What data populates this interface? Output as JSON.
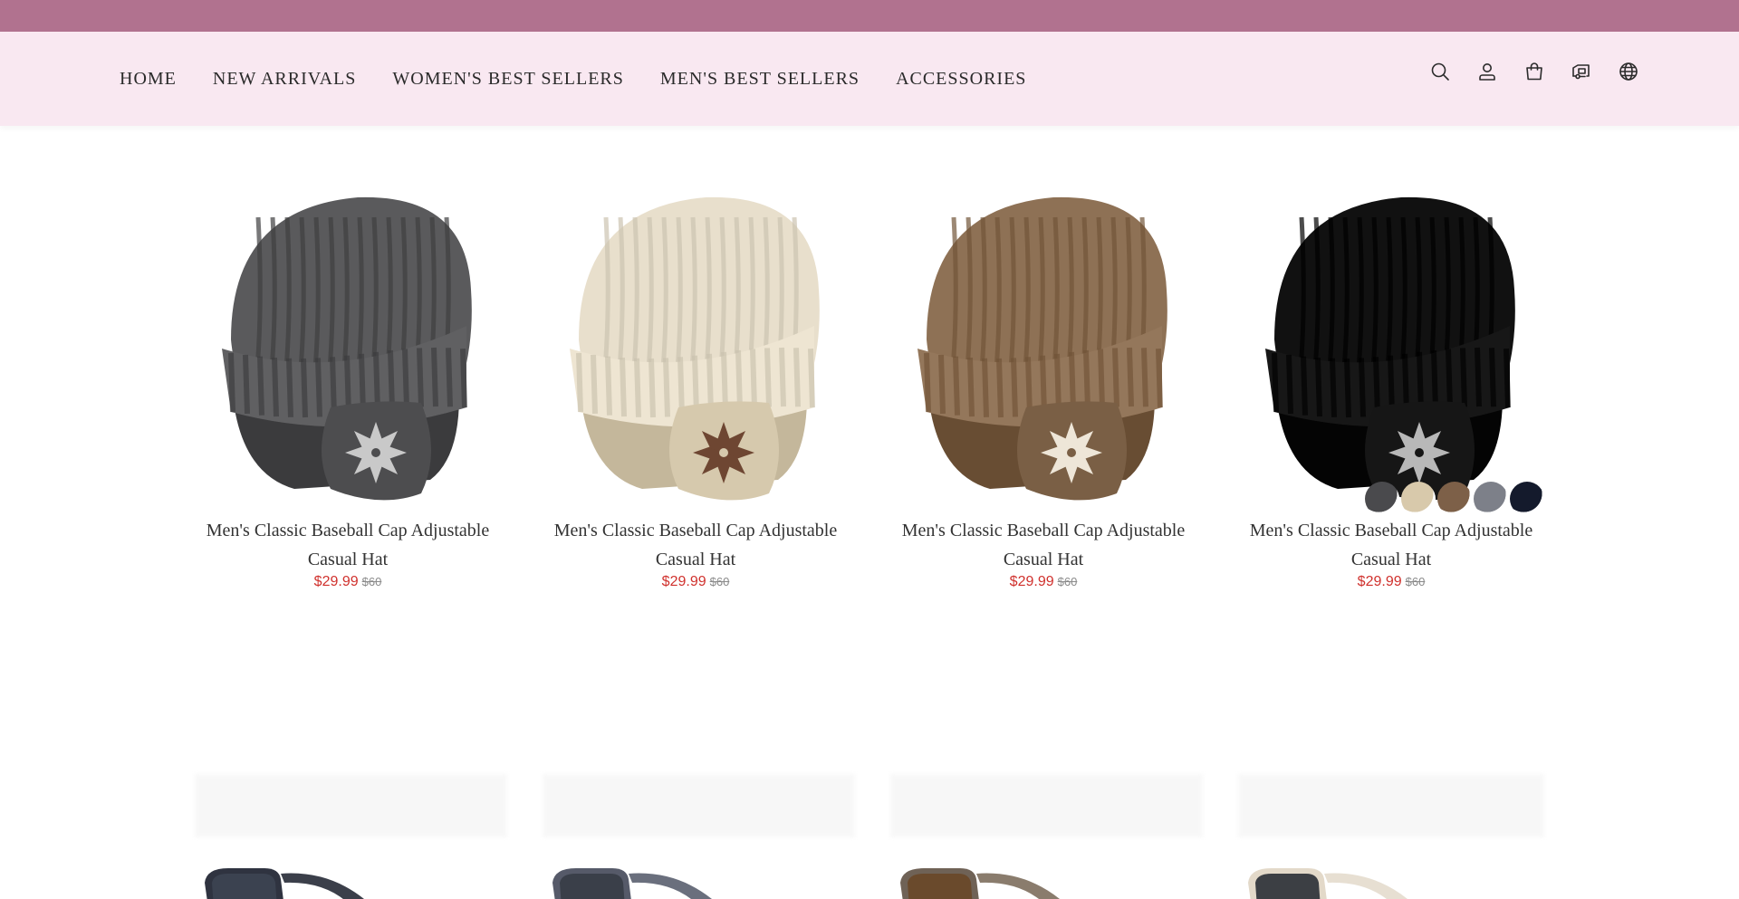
{
  "header": {
    "nav": [
      {
        "label": "HOME"
      },
      {
        "label": "NEW ARRIVALS"
      },
      {
        "label": "WOMEN'S BEST SELLERS"
      },
      {
        "label": "MEN'S BEST SELLERS"
      },
      {
        "label": "ACCESSORIES"
      }
    ],
    "icons": [
      "search-icon",
      "account-icon",
      "cart-icon",
      "shipping-icon",
      "globe-icon"
    ]
  },
  "products": [
    {
      "title": "Men's Classic Baseball Cap Adjustable Casual Hat",
      "price": "$29.99",
      "original_price": "$60",
      "color": "#5a5a5c",
      "ear_color": "#4d4d4f",
      "snowflake": "#c9c9c9"
    },
    {
      "title": "Men's Classic Baseball Cap Adjustable Casual Hat",
      "price": "$29.99",
      "original_price": "$60",
      "color": "#e8dfcc",
      "ear_color": "#d6c9ad",
      "snowflake": "#6e4632"
    },
    {
      "title": "Men's Classic Baseball Cap Adjustable Casual Hat",
      "price": "$29.99",
      "original_price": "$60",
      "color": "#8e7155",
      "ear_color": "#7a5f45",
      "snowflake": "#eee6d8"
    },
    {
      "title": "Men's Classic Baseball Cap Adjustable Casual Hat",
      "price": "$29.99",
      "original_price": "$60",
      "color": "#111111",
      "ear_color": "#161616",
      "snowflake": "#b8b8b8"
    }
  ],
  "swatches": [
    "#4a4a4d",
    "#d8c9ab",
    "#7d6048",
    "#7d8089",
    "#141a2c"
  ],
  "colors": {
    "topbar": "#b1728f",
    "header_bg": "#f9e8f1",
    "sale_price": "#d0312d"
  }
}
